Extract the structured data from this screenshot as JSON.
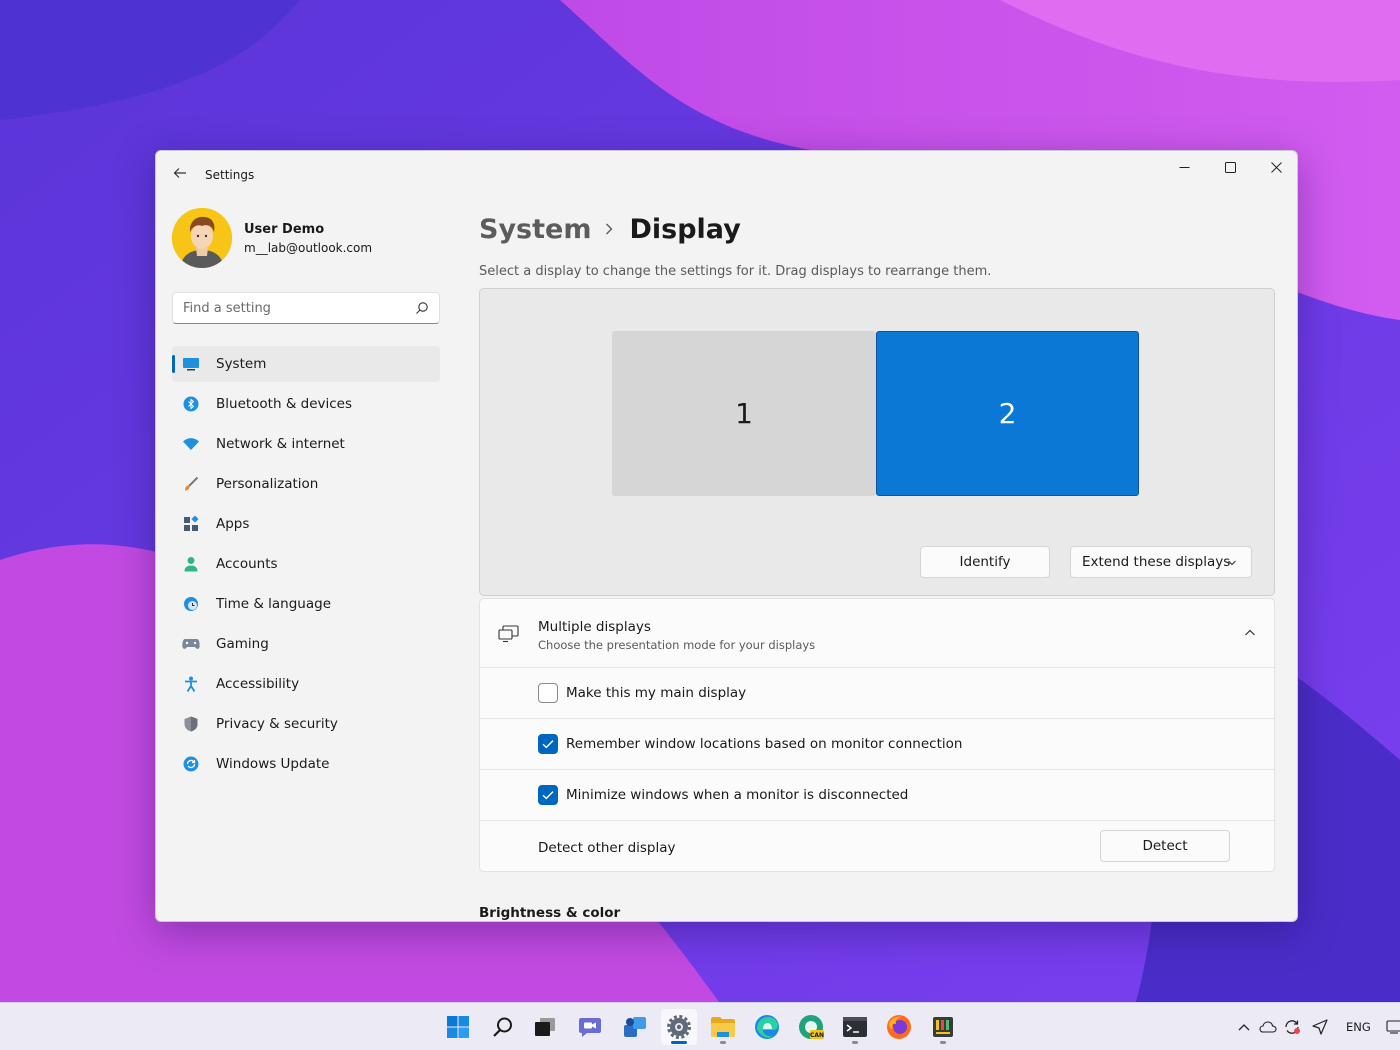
{
  "window": {
    "app_title": "Settings"
  },
  "profile": {
    "name": "User Demo",
    "email": "m__lab@outlook.com"
  },
  "search": {
    "placeholder": "Find a setting",
    "value": ""
  },
  "sidebar": {
    "items": [
      {
        "label": "System",
        "icon": "system-icon",
        "active": true
      },
      {
        "label": "Bluetooth & devices",
        "icon": "bluetooth-icon"
      },
      {
        "label": "Network & internet",
        "icon": "wifi-icon"
      },
      {
        "label": "Personalization",
        "icon": "brush-icon"
      },
      {
        "label": "Apps",
        "icon": "apps-icon"
      },
      {
        "label": "Accounts",
        "icon": "person-icon"
      },
      {
        "label": "Time & language",
        "icon": "globe-clock-icon"
      },
      {
        "label": "Gaming",
        "icon": "gamepad-icon"
      },
      {
        "label": "Accessibility",
        "icon": "accessibility-icon"
      },
      {
        "label": "Privacy & security",
        "icon": "shield-icon"
      },
      {
        "label": "Windows Update",
        "icon": "update-icon"
      }
    ]
  },
  "main": {
    "breadcrumb_parent": "System",
    "breadcrumb_current": "Display",
    "instruction": "Select a display to change the settings for it. Drag displays to rearrange them.",
    "monitors": [
      {
        "number": "1",
        "selected": false
      },
      {
        "number": "2",
        "selected": true
      }
    ],
    "identify_label": "Identify",
    "display_mode_value": "Extend these displays",
    "multiple_displays": {
      "title": "Multiple displays",
      "subtitle": "Choose the presentation mode for your displays",
      "expanded": true,
      "options": [
        {
          "label": "Make this my main display",
          "checked": false
        },
        {
          "label": "Remember window locations based on monitor connection",
          "checked": true
        },
        {
          "label": "Minimize windows when a monitor is disconnected",
          "checked": true
        }
      ],
      "detect_label": "Detect other display",
      "detect_button": "Detect"
    },
    "next_section_heading": "Brightness & color"
  },
  "taskbar": {
    "language": "ENG",
    "accent": "#0067c0",
    "apps": [
      "start-icon",
      "search-icon",
      "task-view-icon",
      "chat-icon",
      "widgets-icon",
      "settings-icon",
      "file-explorer-icon",
      "edge-icon",
      "edge-canary-icon",
      "terminal-icon",
      "firefox-icon",
      "app-icon"
    ]
  }
}
